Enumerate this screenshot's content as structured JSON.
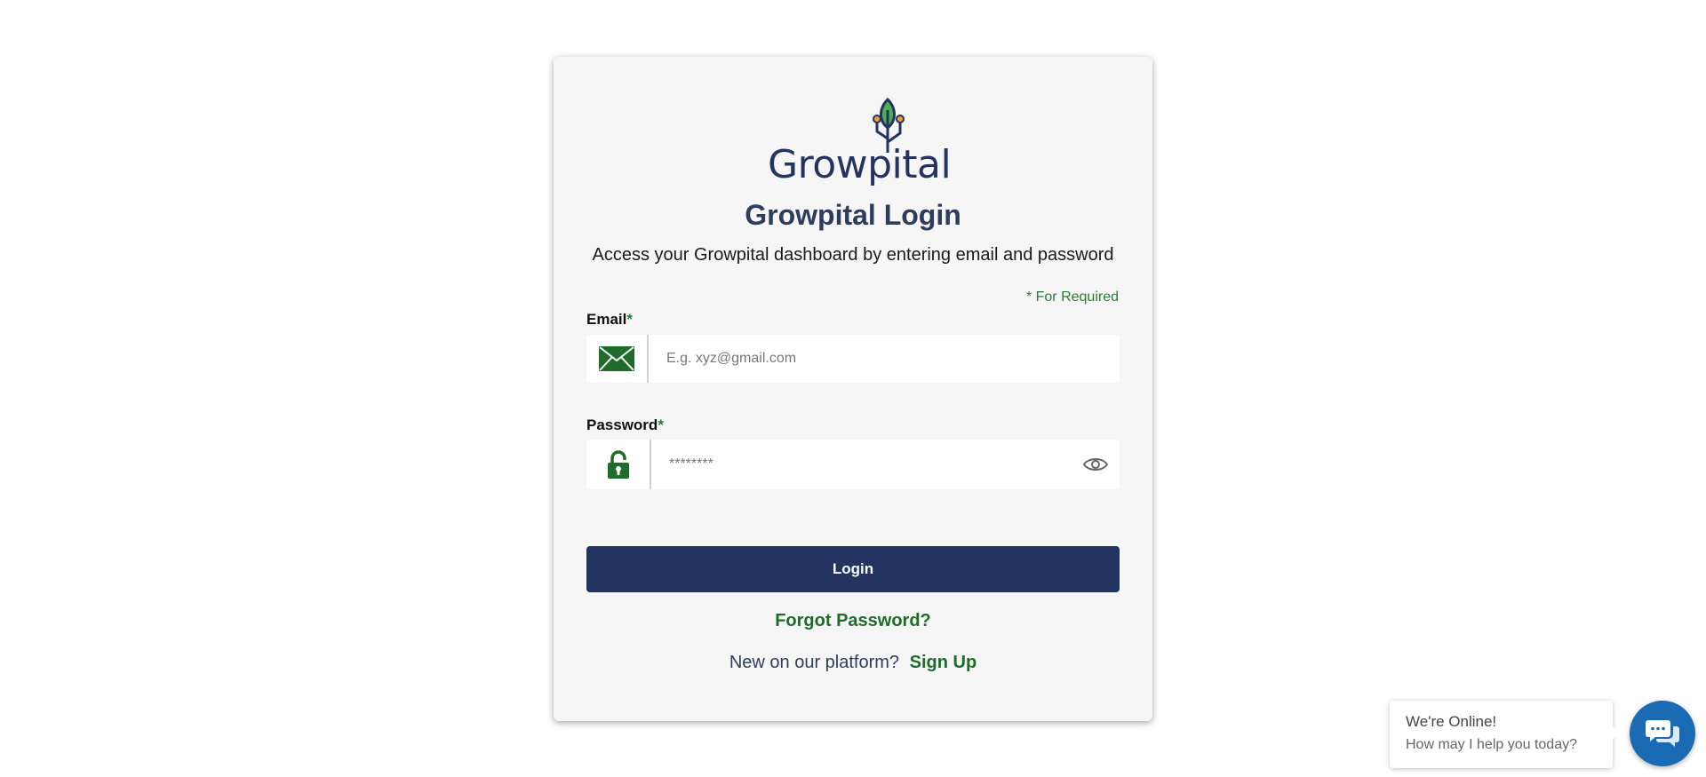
{
  "brand": {
    "logo_text": "Growpital",
    "colors": {
      "navy": "#22345f",
      "green": "#2d7a35",
      "leaf": "#4caf50",
      "orange": "#f0a030"
    }
  },
  "login": {
    "title": "Growpital Login",
    "subtitle": "Access your Growpital dashboard by entering email and password",
    "required_note": "* For Required",
    "email": {
      "label": "Email",
      "required_mark": "*",
      "placeholder": "E.g. xyz@gmail.com",
      "value": "",
      "icon": "envelope-icon"
    },
    "password": {
      "label": "Password",
      "required_mark": "*",
      "placeholder": "********",
      "value": "",
      "icon": "lock-icon",
      "toggle_icon": "eye-icon"
    },
    "login_button": "Login",
    "forgot_password": "Forgot Password?",
    "signup_prompt": "New on our platform?",
    "signup_link": "Sign Up"
  },
  "chat_widget": {
    "title": "We're Online!",
    "subtitle": "How may I help you today?",
    "icon": "chat-icon"
  }
}
